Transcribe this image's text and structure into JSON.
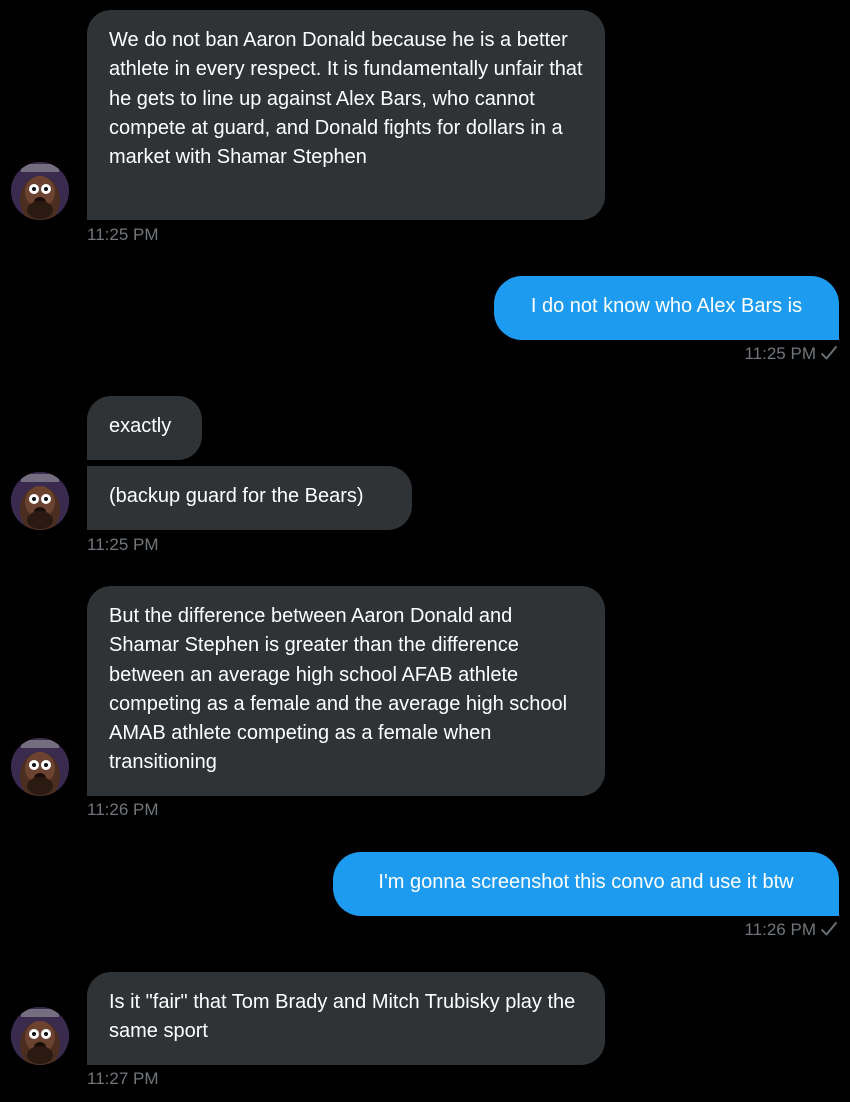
{
  "conversation": {
    "messages": [
      {
        "side": "incoming",
        "text": "We do not ban Aaron Donald because he is a better athlete in every respect. It is fundamentally unfair that he gets to line up against Alex Bars, who cannot compete at guard, and Donald fights for dollars in a market with Shamar Stephen"
      },
      {
        "side": "outgoing",
        "text": "I do not know who Alex Bars is"
      },
      {
        "side": "incoming",
        "text": "exactly"
      },
      {
        "side": "incoming",
        "text": "(backup guard for the Bears)"
      },
      {
        "side": "incoming",
        "text": "But the difference between Aaron Donald and Shamar Stephen is greater than the difference between an average high school AFAB athlete competing as a female and the average high school AMAB athlete competing as a female when transitioning"
      },
      {
        "side": "outgoing",
        "text": "I'm gonna screenshot this convo and use it btw"
      },
      {
        "side": "incoming",
        "text": "Is it \"fair\" that Tom Brady and Mitch Trubisky play the same sport"
      }
    ],
    "timestamps": [
      "11:25 PM",
      "11:25 PM",
      "11:25 PM",
      "11:26 PM",
      "11:26 PM",
      "11:27 PM"
    ]
  },
  "colors": {
    "background": "#000000",
    "incoming_bubble": "#2f3336",
    "outgoing_bubble": "#1d9bf0",
    "timestamp": "#71767b"
  },
  "icons": {
    "avatar": "avatar",
    "read_receipt": "check-icon"
  }
}
